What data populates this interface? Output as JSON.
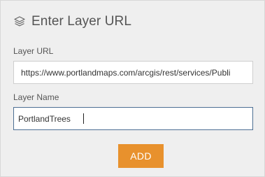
{
  "dialog": {
    "icon": "layers-icon",
    "title": "Enter Layer URL"
  },
  "form": {
    "url_label": "Layer URL",
    "url_value": "https://www.portlandmaps.com/arcgis/rest/services/Publi",
    "name_label": "Layer Name",
    "name_value": "PortlandTrees"
  },
  "actions": {
    "add_label": "ADD"
  },
  "colors": {
    "accent": "#e8912d",
    "focus_border": "#4c6f93",
    "panel_bg": "#efefef"
  }
}
